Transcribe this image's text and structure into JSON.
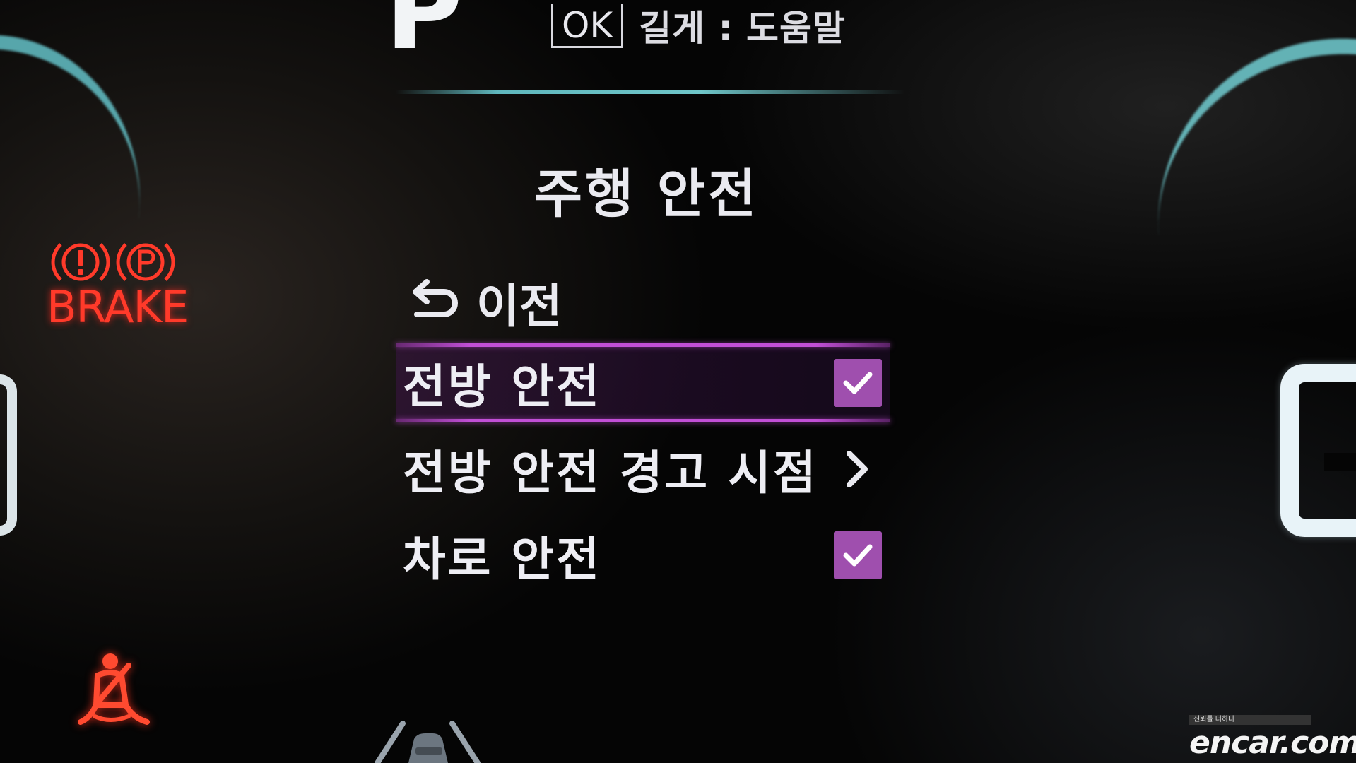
{
  "gear": "P",
  "help_hint": {
    "key_label": "OK",
    "text": "길게 : 도움말"
  },
  "menu": {
    "title": "주행 안전",
    "back_label": "이전",
    "items": [
      {
        "label": "전방 안전",
        "control": "checkbox",
        "checked": true,
        "selected": true
      },
      {
        "label": "전방 안전 경고 시점",
        "control": "submenu",
        "selected": false
      },
      {
        "label": "차로 안전",
        "control": "checkbox",
        "checked": true,
        "selected": false
      }
    ]
  },
  "warnings": {
    "brake_text": "BRAKE",
    "brake_icons": [
      "exclamation-circle-icon",
      "parking-brake-icon"
    ],
    "seatbelt_icon": "seatbelt-warning-icon",
    "brake_color": "#ff3a2a"
  },
  "watermark": {
    "tag": "신뢰를 더하다",
    "brand": "encar.com"
  },
  "colors": {
    "accent_purple": "#c14fd6",
    "checkbox_fill": "#9f4fae",
    "teal": "#5fb7bd"
  }
}
